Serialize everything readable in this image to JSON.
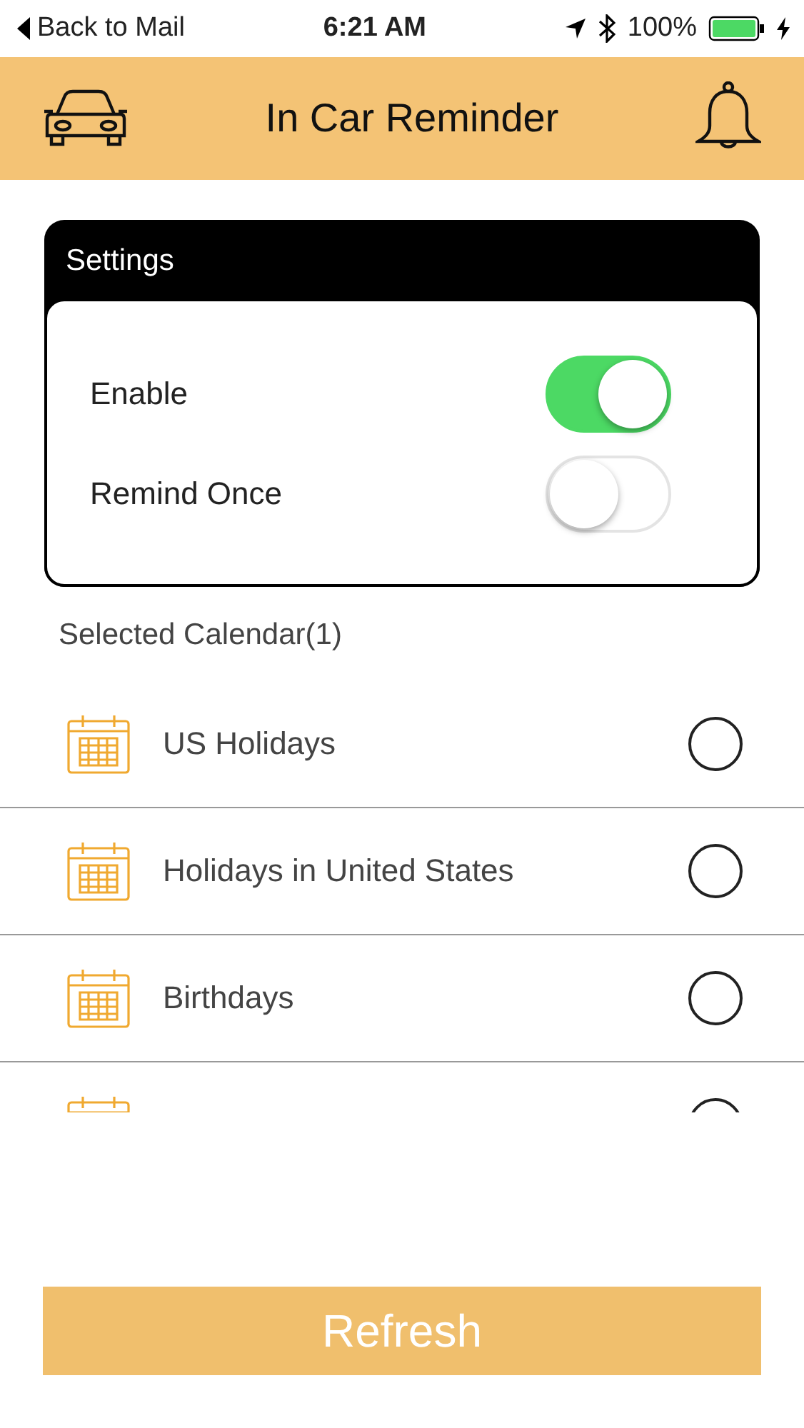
{
  "status_bar": {
    "back": "Back to Mail",
    "time": "6:21 AM",
    "battery": "100%"
  },
  "header": {
    "title": "In Car Reminder"
  },
  "settings": {
    "title": "Settings",
    "toggles": [
      {
        "label": "Enable",
        "on": true
      },
      {
        "label": "Remind Once",
        "on": false
      }
    ]
  },
  "calendar_heading": "Selected Calendar(1)",
  "calendars": [
    {
      "name": "US Holidays",
      "selected": false
    },
    {
      "name": "Holidays in United States",
      "selected": false
    },
    {
      "name": "Birthdays",
      "selected": false
    },
    {
      "selected": false
    }
  ],
  "refresh_button": "Refresh"
}
